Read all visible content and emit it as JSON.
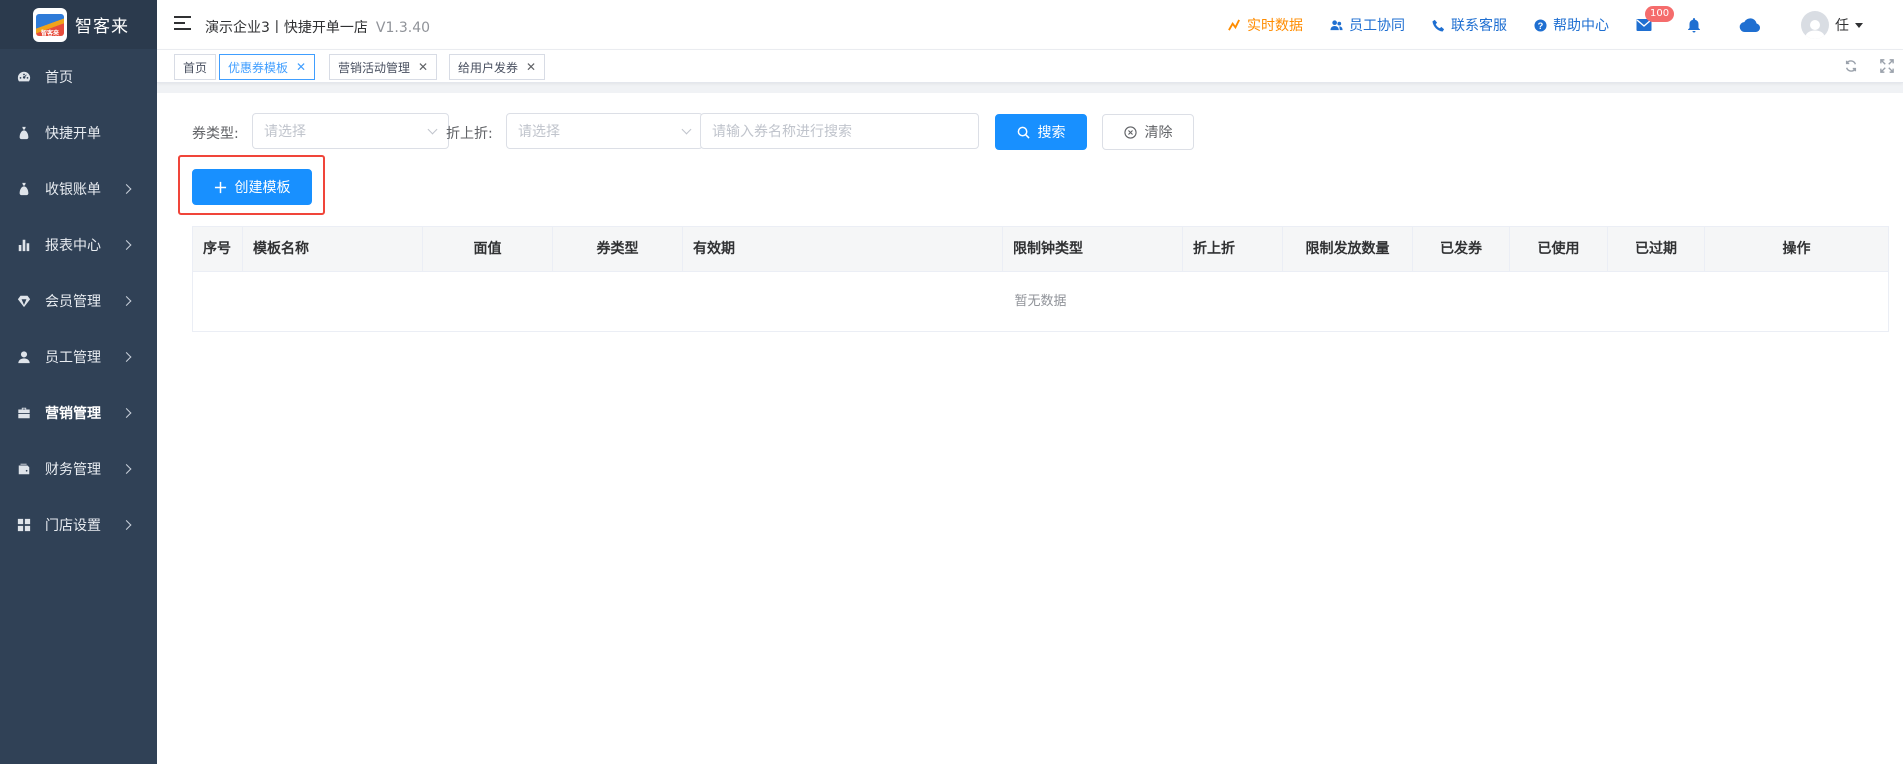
{
  "app": {
    "logo_small": "智客来",
    "name": "智客来"
  },
  "sidebar": {
    "items": [
      {
        "label": "首页",
        "icon": "dashboard-icon"
      },
      {
        "label": "快捷开单",
        "icon": "money-bag-icon"
      },
      {
        "label": "收银账单",
        "icon": "money-bag-icon"
      },
      {
        "label": "报表中心",
        "icon": "bar-chart-icon"
      },
      {
        "label": "会员管理",
        "icon": "diamond-icon"
      },
      {
        "label": "员工管理",
        "icon": "user-icon"
      },
      {
        "label": "营销管理",
        "icon": "briefcase-icon"
      },
      {
        "label": "财务管理",
        "icon": "wallet-icon"
      },
      {
        "label": "门店设置",
        "icon": "grid-icon"
      }
    ]
  },
  "header": {
    "title": "演示企业3丨快捷开单一店",
    "version": "V1.3.40",
    "links": {
      "realtime": "实时数据",
      "staff": "员工协同",
      "contact": "联系客服",
      "help": "帮助中心"
    },
    "mail_count": "100",
    "user_name": "任"
  },
  "tags": {
    "items": [
      {
        "label": "首页",
        "closable": false,
        "active": false
      },
      {
        "label": "优惠券模板",
        "closable": true,
        "active": true
      },
      {
        "label": "营销活动管理",
        "closable": true,
        "active": false
      },
      {
        "label": "给用户发券",
        "closable": true,
        "active": false
      }
    ],
    "close_glyph": "✕"
  },
  "filters": {
    "type_label": "券类型:",
    "type_placeholder": "请选择",
    "discount_label": "折上折:",
    "discount_placeholder": "请选择",
    "search_placeholder": "请输入券名称进行搜索",
    "search_button": "搜索",
    "clear_button": "清除"
  },
  "actions": {
    "create_button": "创建模板"
  },
  "table": {
    "columns": [
      "序号",
      "模板名称",
      "面值",
      "券类型",
      "有效期",
      "限制钟类型",
      "折上折",
      "限制发放数量",
      "已发券",
      "已使用",
      "已过期",
      "操作"
    ],
    "empty_text": "暂无数据"
  },
  "colors": {
    "sidebar_bg": "#304156",
    "primary": "#1890ff",
    "highlight_border": "#f0453a",
    "badge": "#f56c6c",
    "orange_link": "#ff8c00"
  }
}
